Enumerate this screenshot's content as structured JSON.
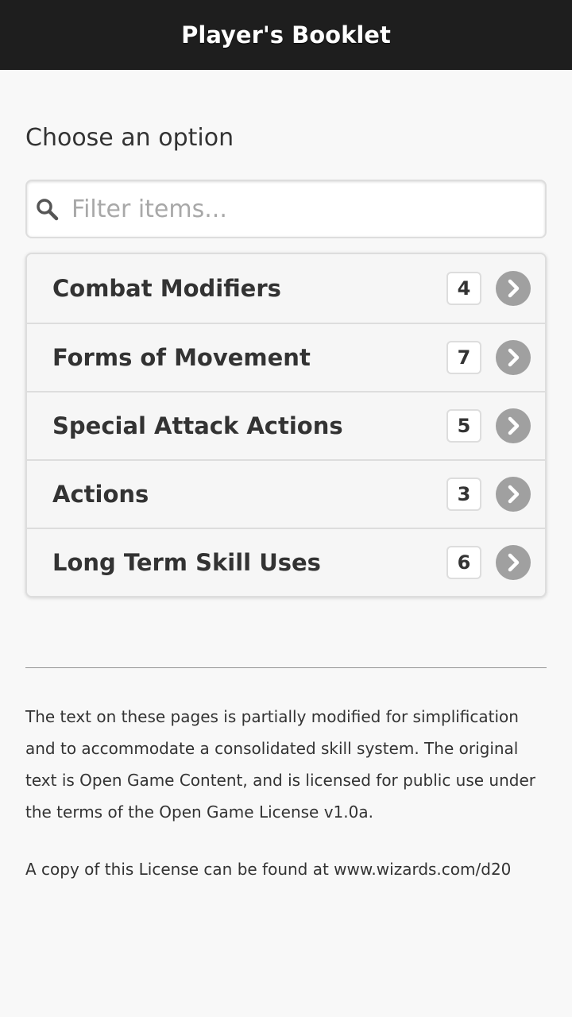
{
  "header": {
    "title": "Player's Booklet"
  },
  "prompt": "Choose an option",
  "search": {
    "placeholder": "Filter items...",
    "value": ""
  },
  "items": [
    {
      "label": "Combat Modifiers",
      "count": "4"
    },
    {
      "label": "Forms of Movement",
      "count": "7"
    },
    {
      "label": "Special Attack Actions",
      "count": "5"
    },
    {
      "label": "Actions",
      "count": "3"
    },
    {
      "label": "Long Term Skill Uses",
      "count": "6"
    }
  ],
  "footer": {
    "license_text": "The text on these pages is partially modified for simplification and to accommodate a consolidated skill system. The original text is Open Game Content, and is licensed for public use under the terms of the Open Game License v1.0a.",
    "license_link_text": "A copy of this License can be found at www.wizards.com/d20"
  },
  "colors": {
    "header_bg": "#1e1e1e",
    "page_bg": "#f8f8f8",
    "chevron_bg": "#a0a0a0"
  },
  "icons": {
    "search": "search-icon",
    "arrow": "chevron-right-icon"
  }
}
